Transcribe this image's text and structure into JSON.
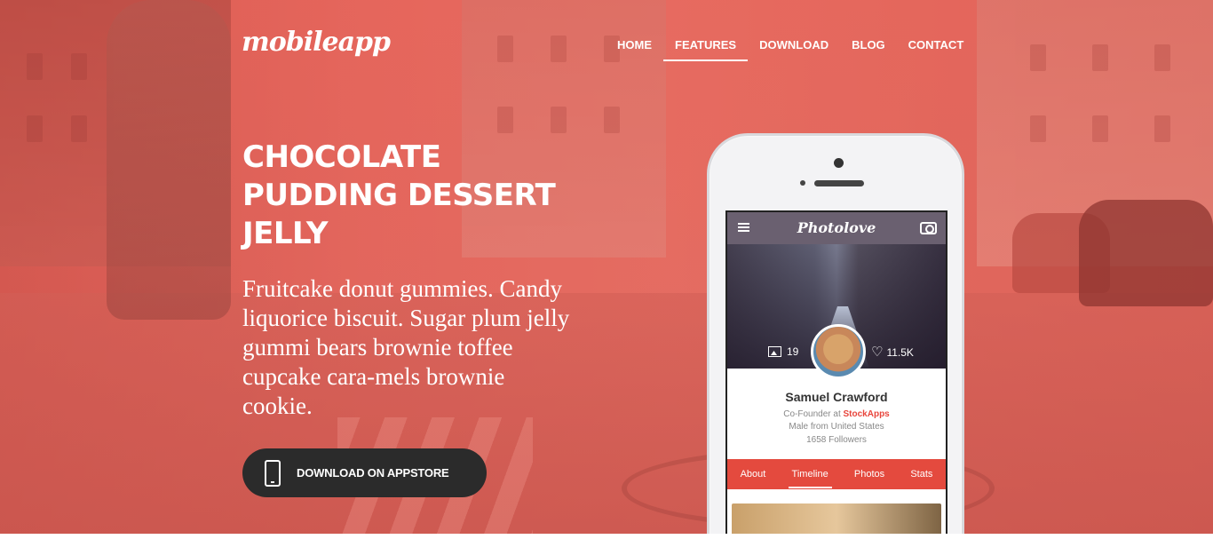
{
  "site": {
    "logo": "mobileapp"
  },
  "nav": [
    {
      "label": "HOME",
      "active": false
    },
    {
      "label": "FEATURES",
      "active": true
    },
    {
      "label": "DOWNLOAD",
      "active": false
    },
    {
      "label": "BLOG",
      "active": false
    },
    {
      "label": "CONTACT",
      "active": false
    }
  ],
  "hero": {
    "headline": "CHOCOLATE PUDDING DESSERT JELLY",
    "lead": "Fruitcake donut gummies. Candy liquorice biscuit. Sugar plum jelly gummi bears brownie toffee cupcake cara-mels brownie cookie.",
    "cta_label": "DOWNLOAD ON APPSTORE",
    "cta_icon": "smartphone-icon"
  },
  "phone_app": {
    "title": "Photolove",
    "photos_count": "19",
    "likes_count": "11.5K",
    "profile": {
      "name": "Samuel Crawford",
      "role_prefix": "Co-Founder at ",
      "company": "StockApps",
      "location": "Male from United States",
      "followers": "1658 Followers"
    },
    "tabs": [
      {
        "label": "About",
        "active": false
      },
      {
        "label": "Timeline",
        "active": true
      },
      {
        "label": "Photos",
        "active": false
      },
      {
        "label": "Stats",
        "active": false
      }
    ]
  },
  "colors": {
    "accent": "#e44a3e",
    "hero_overlay": "#e2685d",
    "cta_bg": "#2b2b2b",
    "company": "#e8453c"
  }
}
